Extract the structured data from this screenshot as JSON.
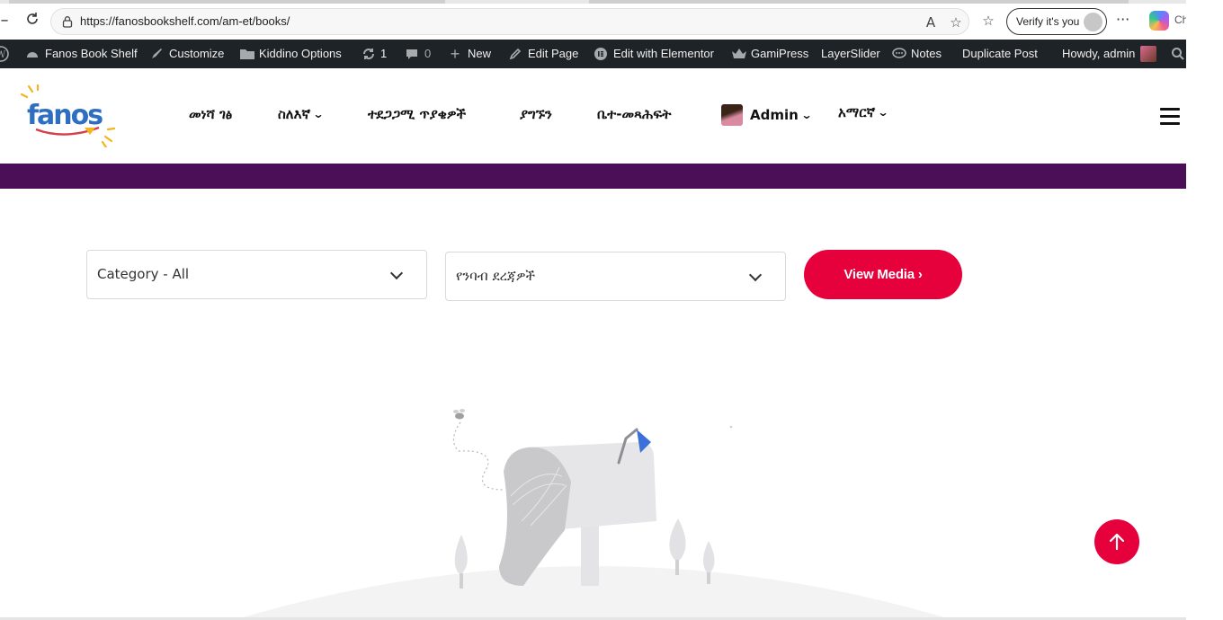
{
  "browser": {
    "url": "https://fanosbookshelf.com/am-et/books/",
    "verify_label": "Verify it's you",
    "copilot_label": "Ch"
  },
  "adminbar": {
    "site_name": "Fanos Book Shelf",
    "customize": "Customize",
    "kiddino_options": "Kiddino Options",
    "updates_count": "1",
    "comments_count": "0",
    "new": "New",
    "edit_page": "Edit Page",
    "edit_elementor": "Edit with Elementor",
    "gamipress": "GamiPress",
    "layerslider": "LayerSlider",
    "notes": "Notes",
    "duplicate_post": "Duplicate Post",
    "howdy": "Howdy, admin"
  },
  "site": {
    "logo_text": "fanos",
    "menu": [
      {
        "label": "መነሻ ገፅ",
        "has_dropdown": false
      },
      {
        "label": "ስለእኛ",
        "has_dropdown": true
      },
      {
        "label": "ተደጋጋሚ ጥያቄዎች",
        "has_dropdown": false
      },
      {
        "label": "ያግኙን",
        "has_dropdown": false
      },
      {
        "label": "ቤተ-መጻሕፍት",
        "has_dropdown": false
      },
      {
        "label": "Admin",
        "has_dropdown": true
      },
      {
        "label": "አማርኛ",
        "has_dropdown": true
      }
    ]
  },
  "filters": {
    "category": "Category - All",
    "reading_level": "የንባብ ደረጃዎች",
    "view_button": "View Media"
  },
  "colors": {
    "accent": "#e6003c",
    "band": "#4a0f57",
    "adminbar": "#1d2327"
  }
}
